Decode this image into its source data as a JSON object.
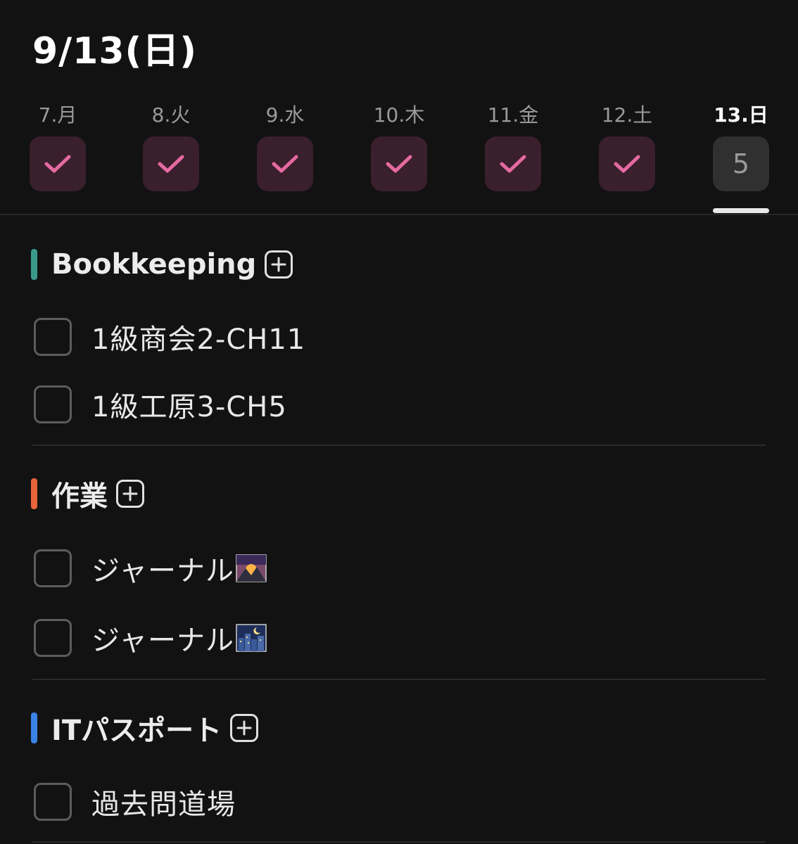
{
  "header": {
    "title": "9/13(日)"
  },
  "week": {
    "days": [
      {
        "label": "7.月",
        "state": "done"
      },
      {
        "label": "8.火",
        "state": "done"
      },
      {
        "label": "9.水",
        "state": "done"
      },
      {
        "label": "10.木",
        "state": "done"
      },
      {
        "label": "11.金",
        "state": "done"
      },
      {
        "label": "12.土",
        "state": "done"
      },
      {
        "label": "13.日",
        "state": "today",
        "count": "5"
      }
    ]
  },
  "sections": [
    {
      "title": "Bookkeeping",
      "color": "#3a9a8a",
      "tasks": [
        {
          "label": "1級商会2-CH11",
          "checked": false
        },
        {
          "label": "1級工原3-CH5",
          "checked": false
        }
      ]
    },
    {
      "title": "作業",
      "color": "#e8643a",
      "tasks": [
        {
          "label": "ジャーナル",
          "emoji": "sunrise-over-mountains-icon",
          "checked": false
        },
        {
          "label": "ジャーナル",
          "emoji": "night-city-icon",
          "checked": false
        }
      ]
    },
    {
      "title": "ITパスポート",
      "color": "#3b82e6",
      "tasks": [
        {
          "label": "過去問道場",
          "checked": false
        }
      ]
    }
  ],
  "colors": {
    "check": "#e56aa0",
    "done_box": "#3a1f2c",
    "today_box": "#303030"
  }
}
